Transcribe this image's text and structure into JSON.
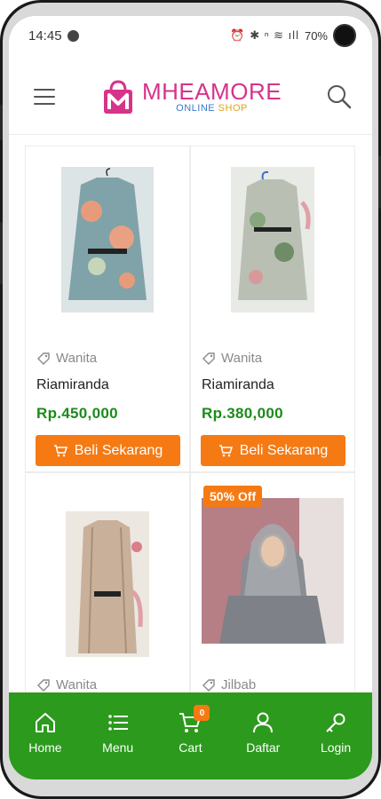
{
  "status_bar": {
    "time": "14:45",
    "battery": "70%"
  },
  "header": {
    "brand_name": "MHEAMORE",
    "brand_sub_a": "ONLINE",
    "brand_sub_b": "SHOP"
  },
  "products": [
    {
      "category": "Wanita",
      "name": "Riamiranda",
      "price": "Rp.450,000",
      "button": "Beli Sekarang"
    },
    {
      "category": "Wanita",
      "name": "Riamiranda",
      "price": "Rp.380,000",
      "button": "Beli Sekarang"
    },
    {
      "category": "Wanita",
      "name": "",
      "price": "",
      "button": ""
    },
    {
      "category": "Jilbab",
      "name": "",
      "price": "",
      "button": "",
      "badge": "50% Off"
    }
  ],
  "bottom_nav": {
    "items": [
      {
        "label": "Home",
        "icon": "home-icon"
      },
      {
        "label": "Menu",
        "icon": "menu-list-icon"
      },
      {
        "label": "Cart",
        "icon": "cart-icon",
        "badge": "0"
      },
      {
        "label": "Daftar",
        "icon": "user-icon"
      },
      {
        "label": "Login",
        "icon": "key-icon"
      }
    ]
  },
  "colors": {
    "brand_pink": "#d6338a",
    "price_green": "#1a8c1a",
    "button_orange": "#f57a14",
    "nav_green": "#2c9a1d"
  }
}
